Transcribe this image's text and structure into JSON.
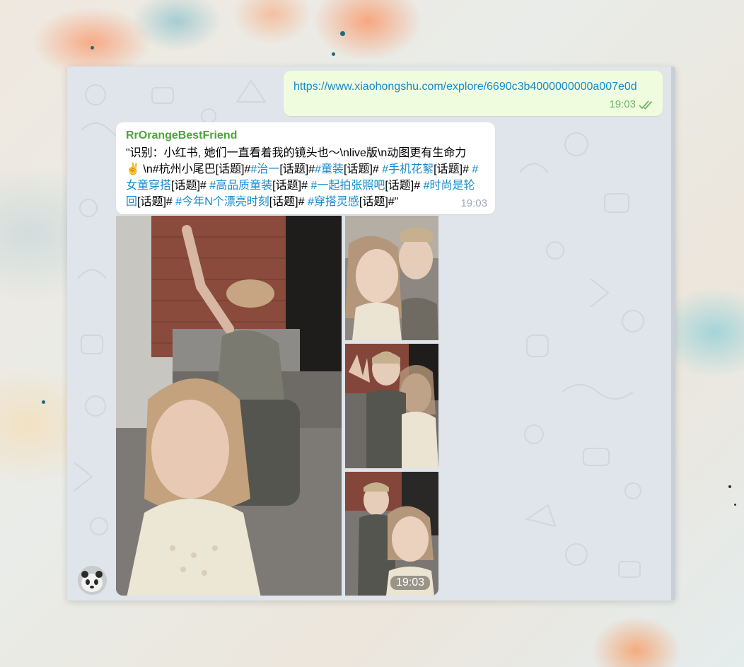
{
  "chat": {
    "outgoing": {
      "link_text": "https://www.xiaohongshu.com/explore/6690c3b4000000000a007e0d",
      "time": "19:03",
      "status_icon": "double-check-icon"
    },
    "incoming": {
      "sender": "RrOrangeBestFriend",
      "text_parts": [
        {
          "t": "\"识别：小红书, 她们一直看着我的镜头也～\\nlive版\\n动图更有生命力✌️ \\n#杭州小尾巴[话题]#",
          "tag": false
        },
        {
          "t": "#治一",
          "tag": true
        },
        {
          "t": "[话题]#",
          "tag": false
        },
        {
          "t": "#童装",
          "tag": true
        },
        {
          "t": "[话题]# ",
          "tag": false
        },
        {
          "t": "#手机花絮",
          "tag": true
        },
        {
          "t": "[话题]# ",
          "tag": false
        },
        {
          "t": "#女童穿搭",
          "tag": true
        },
        {
          "t": "[话题]# ",
          "tag": false
        },
        {
          "t": "#高品质童装",
          "tag": true
        },
        {
          "t": "[话题]# ",
          "tag": false
        },
        {
          "t": "#一起拍张照吧",
          "tag": true
        },
        {
          "t": "[话题]# ",
          "tag": false
        },
        {
          "t": "#时尚是轮回",
          "tag": true
        },
        {
          "t": "[话题]# ",
          "tag": false
        },
        {
          "t": "#今年N个漂亮时刻",
          "tag": true
        },
        {
          "t": "[话题]# ",
          "tag": false
        },
        {
          "t": "#穿搭灵感",
          "tag": true
        },
        {
          "t": "[话题]#\"",
          "tag": false
        }
      ],
      "time": "19:03"
    },
    "album": {
      "time": "19:03",
      "photo_count": 4
    }
  },
  "colors": {
    "outgoing_bubble": "#effdde",
    "incoming_bubble": "#ffffff",
    "sender_name": "#4ea33a",
    "link": "#168acd",
    "chat_background": "#dfe5ea"
  }
}
